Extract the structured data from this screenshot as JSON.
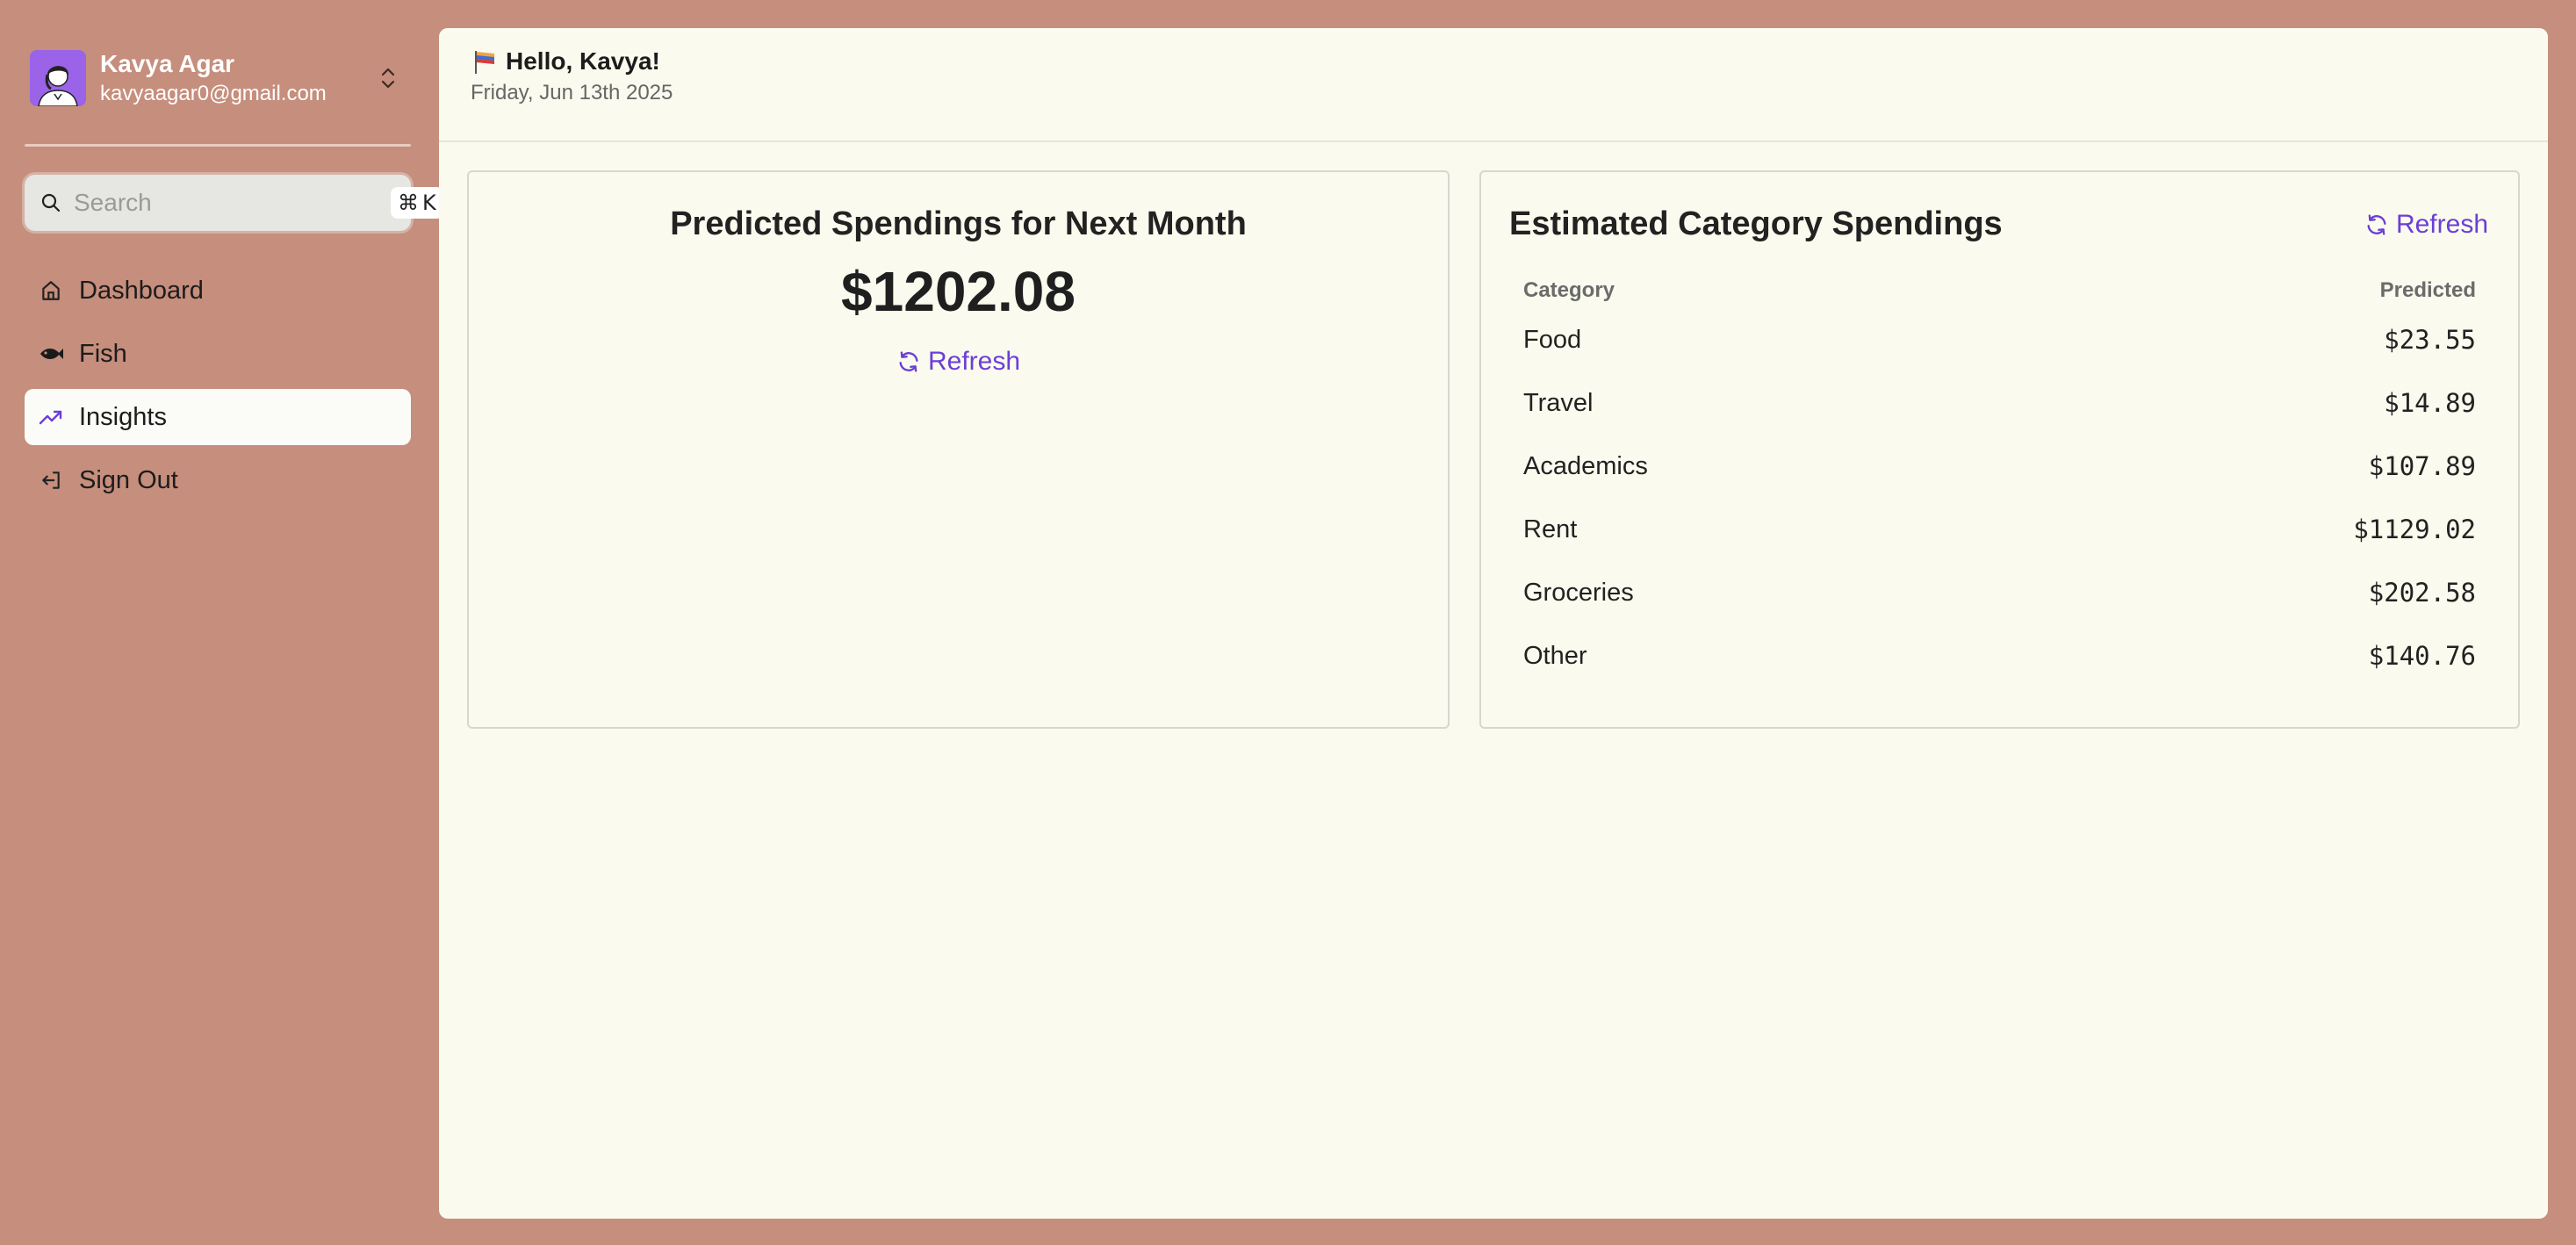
{
  "user": {
    "name": "Kavya Agar",
    "email": "kavyaagar0@gmail.com"
  },
  "search": {
    "placeholder": "Search",
    "shortcut_symbol": "⌘",
    "shortcut_key": "K"
  },
  "nav": {
    "items": [
      {
        "label": "Dashboard",
        "icon": "home-icon"
      },
      {
        "label": "Fish",
        "icon": "fish-icon"
      },
      {
        "label": "Insights",
        "icon": "trending-up-icon",
        "active": true
      },
      {
        "label": "Sign Out",
        "icon": "sign-out-icon"
      }
    ]
  },
  "header": {
    "greeting": "Hello, Kavya!",
    "date": "Friday, Jun 13th 2025"
  },
  "prediction": {
    "title": "Predicted Spendings for Next Month",
    "amount": "$1202.08",
    "refresh_label": "Refresh"
  },
  "categories": {
    "title": "Estimated Category Spendings",
    "refresh_label": "Refresh",
    "col_category": "Category",
    "col_predicted": "Predicted",
    "rows": [
      {
        "category": "Food",
        "predicted": "$23.55"
      },
      {
        "category": "Travel",
        "predicted": "$14.89"
      },
      {
        "category": "Academics",
        "predicted": "$107.89"
      },
      {
        "category": "Rent",
        "predicted": "$1129.02"
      },
      {
        "category": "Groceries",
        "predicted": "$202.58"
      },
      {
        "category": "Other",
        "predicted": "$140.76"
      }
    ]
  },
  "colors": {
    "background": "#c68e7c",
    "panel": "#fafbee",
    "accent": "#6b3fd6",
    "avatar_bg": "#9a63e8"
  }
}
